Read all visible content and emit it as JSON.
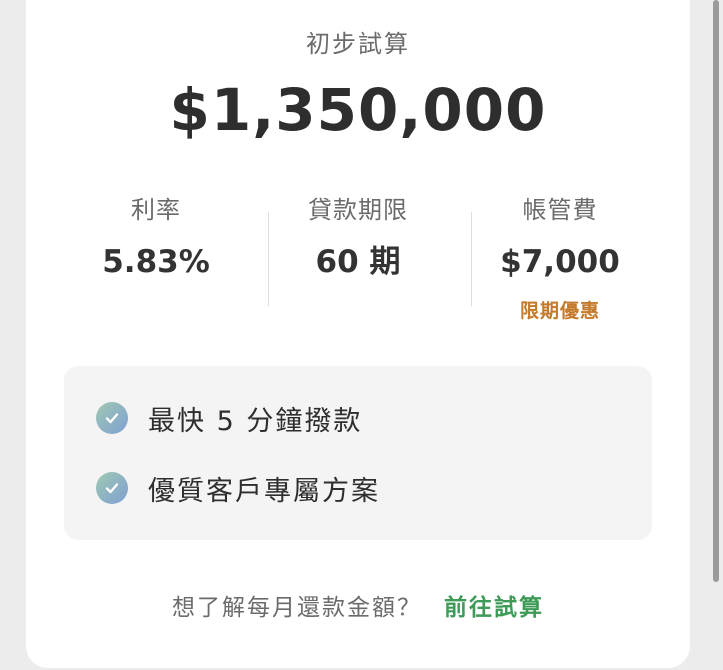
{
  "estimate": {
    "title": "初步試算",
    "amount": "$1,350,000"
  },
  "stats": [
    {
      "label": "利率",
      "value": "5.83%"
    },
    {
      "label": "貸款期限",
      "value": "60 期"
    },
    {
      "label": "帳管費",
      "value": "$7,000",
      "promo": "限期優惠"
    }
  ],
  "features": [
    {
      "text": "最快 5 分鐘撥款",
      "icon": "check-circle-icon"
    },
    {
      "text": "優質客戶專屬方案",
      "icon": "check-circle-icon"
    }
  ],
  "footer": {
    "question": "想了解每月還款金額？",
    "link": "前往試算"
  },
  "colors": {
    "promo": "#c47a2a",
    "link": "#3d9a57",
    "check_gradient_start": "#9fc9b2",
    "check_gradient_end": "#7f9fd2"
  }
}
